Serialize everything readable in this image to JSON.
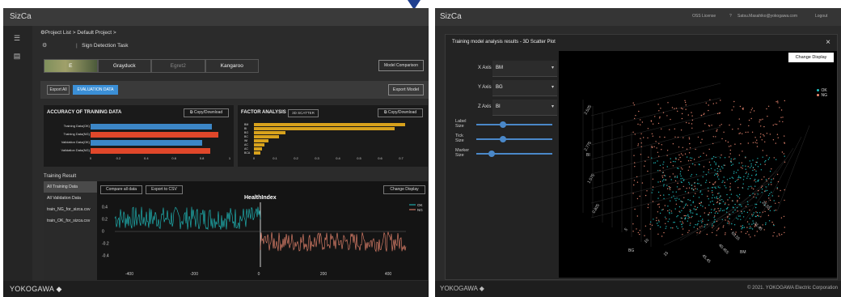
{
  "left": {
    "app_title": "SizCa",
    "breadcrumb": "⚙Project List > Default Project >",
    "task_name": "Sign Detection Task",
    "model_tabs": [
      "E",
      "Grayduck",
      "Egret2",
      "Kangaroo"
    ],
    "model_comparison": "Model Comparison",
    "export_all": "Export All",
    "evaluation_data": "EVALUATION DATA",
    "export_model": "Export Model",
    "accuracy": {
      "title": "ACCURACY OF TRAINING DATA",
      "copy": "Copy/Download",
      "colors": {
        "ok": "#3c86c6",
        "ng": "#e0472a"
      },
      "rows": [
        {
          "label": "Training Data(OK)",
          "value": 0.87,
          "kind": "ok"
        },
        {
          "label": "Training Data(NG)",
          "value": 0.92,
          "kind": "ng"
        },
        {
          "label": "Validation Data(OK)",
          "value": 0.8,
          "kind": "ok"
        },
        {
          "label": "Validation Data(NG)",
          "value": 0.86,
          "kind": "ng"
        }
      ],
      "ticks": [
        "0",
        "0.2",
        "0.4",
        "0.6",
        "0.8",
        "1"
      ]
    },
    "factor": {
      "title": "FACTOR ANALYSIS",
      "badge": "3D SCATTER",
      "copy": "Copy/Download",
      "color": "#d8a21c",
      "rows": [
        {
          "label": "BM",
          "value": 0.72
        },
        {
          "label": "BI",
          "value": 0.67
        },
        {
          "label": "BG",
          "value": 0.15
        },
        {
          "label": "BC",
          "value": 0.12
        },
        {
          "label": "WI",
          "value": 0.07
        },
        {
          "label": "AC",
          "value": 0.05
        },
        {
          "label": "AC",
          "value": 0.04
        },
        {
          "label": "BCA",
          "value": 0.03
        }
      ],
      "ticks": [
        "0",
        "0.1",
        "0.2",
        "0.3",
        "0.4",
        "0.5",
        "0.6",
        "0.7"
      ]
    },
    "training_result": {
      "title": "Training Result",
      "list": [
        "All Training Data",
        "All Validation Data",
        "train_NG_for_sizca.csv",
        "train_OK_for_sizca.csv"
      ],
      "compare": "Compare all data",
      "export_csv": "Export to CSV",
      "change_display": "Change Display",
      "chart_title": "HealthIndex",
      "legend": [
        {
          "name": "OK",
          "color": "#21c4c4"
        },
        {
          "name": "NG",
          "color": "#f08a72"
        }
      ],
      "yticks": [
        "0.4",
        "0.2",
        "0",
        "-0.2",
        "-0.4"
      ],
      "xticks": [
        "-400",
        "-200",
        "0",
        "200",
        "400"
      ]
    },
    "footer_brand": "YOKOGAWA ◆"
  },
  "right": {
    "app_title": "SizCa",
    "oss": "OSS License",
    "user": "Satsu.Masahiko@yokogawa.com",
    "logout": "Logout",
    "dialog_title": "Training model analysis results - 3D Scatter Plot",
    "close": "×",
    "x_axis_label": "X Axis",
    "x_axis_value": "BM",
    "y_axis_label": "Y Axis",
    "y_axis_value": "BG",
    "z_axis_label": "Z Axis",
    "z_axis_value": "BI",
    "label_size": "Label Size",
    "tick_size": "Tick Size",
    "marker_size": "Marker Size",
    "sliders": {
      "label_size": 0.35,
      "tick_size": 0.35,
      "marker_size": 0.2
    },
    "change_display": "Change Display",
    "legend": [
      {
        "name": "OK",
        "color": "#21c4c4"
      },
      {
        "name": "NG",
        "color": "#f08a72"
      }
    ],
    "axis_names": {
      "bi": "BI",
      "bg": "BG",
      "bm": "BM"
    },
    "bi_ticks": [
      "2.525",
      "2.775",
      "1.575",
      "0.825"
    ],
    "bg_ticks": [
      "5",
      "10",
      "15"
    ],
    "bm_ticks": [
      "25.55",
      "31.45",
      "69.55",
      "40.455",
      "45.45"
    ],
    "footer_brand": "YOKOGAWA ◆",
    "copyright": "© 2021. YOKOGAWA Electric Corporation"
  }
}
